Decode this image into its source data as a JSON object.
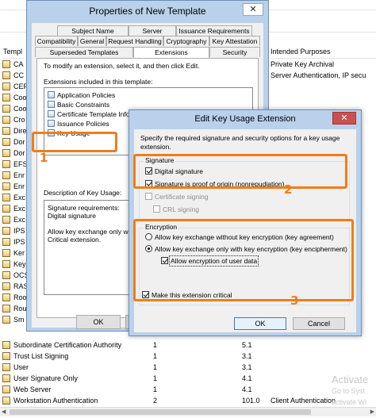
{
  "console": {
    "columns": {
      "name": "Templ",
      "intended_purposes": "Intended Purposes"
    },
    "top_rows": [
      {
        "name": "CA",
        "purposes": "Private Key Archival"
      },
      {
        "name": "CC",
        "purposes": "Server Authentication, IP secu"
      },
      {
        "name": "CEF",
        "purposes": ""
      },
      {
        "name": "Coo",
        "purposes": ""
      },
      {
        "name": "Coo",
        "purposes": ""
      },
      {
        "name": "Cro",
        "purposes": ""
      },
      {
        "name": "Dire",
        "purposes": ""
      },
      {
        "name": "Dor",
        "purposes": ""
      },
      {
        "name": "Dor",
        "purposes": ""
      },
      {
        "name": "EFS",
        "purposes": ""
      },
      {
        "name": "Enr",
        "purposes": ""
      },
      {
        "name": "Enr",
        "purposes": ""
      },
      {
        "name": "Exc",
        "purposes": ""
      },
      {
        "name": "Exc",
        "purposes": ""
      },
      {
        "name": "Exc",
        "purposes": ""
      },
      {
        "name": "IPS",
        "purposes": ""
      },
      {
        "name": "IPS",
        "purposes": ""
      },
      {
        "name": "Ker",
        "purposes": ""
      },
      {
        "name": "Key",
        "purposes": ""
      },
      {
        "name": "OCS",
        "purposes": ""
      },
      {
        "name": "RAS",
        "purposes": ""
      },
      {
        "name": "Roo",
        "purposes": ""
      },
      {
        "name": "Rou",
        "purposes": ""
      },
      {
        "name": "Sm",
        "purposes": ""
      }
    ],
    "bottom_rows": [
      {
        "name": "Subordinate Certification Authority",
        "c2": "1",
        "c3": "5.1",
        "purposes": ""
      },
      {
        "name": "Trust List Signing",
        "c2": "1",
        "c3": "3.1",
        "purposes": ""
      },
      {
        "name": "User",
        "c2": "1",
        "c3": "3.1",
        "purposes": ""
      },
      {
        "name": "User Signature Only",
        "c2": "1",
        "c3": "4.1",
        "purposes": ""
      },
      {
        "name": "Web Server",
        "c2": "1",
        "c3": "4.1",
        "purposes": ""
      },
      {
        "name": "Workstation Authentication",
        "c2": "2",
        "c3": "101.0",
        "purposes": "Client Authentication"
      }
    ],
    "watermark_line1": "Activate",
    "watermark_line2": "Go to Syst",
    "watermark_line3": "activate Wi"
  },
  "properties_dialog": {
    "title": "Properties of New Template",
    "close_glyph": "✕",
    "tabs_row1": [
      "Subject Name",
      "Server",
      "Issuance Requirements"
    ],
    "tabs_row2": [
      "Compatibility",
      "General",
      "Request Handling",
      "Cryptography",
      "Key Attestation"
    ],
    "tabs_row3": [
      "Superseded Templates",
      "Extensions",
      "Security"
    ],
    "instruction": "To modify an extension, select it, and then click Edit.",
    "list_label": "Extensions included in this template:",
    "extensions": [
      "Application Policies",
      "Basic Constraints",
      "Certificate Template Informa",
      "Issuance Policies",
      "Key Usage"
    ],
    "description_label": "Description of Key Usage:",
    "description_lines": [
      "Signature requirements:",
      "Digital signature",
      "",
      "Allow key exchange only with k",
      "Critical extension."
    ],
    "ok_label": "OK"
  },
  "key_usage_dialog": {
    "title": "Edit Key Usage Extension",
    "close_glyph": "✕",
    "description": "Specify the required signature and security options for a key usage extension.",
    "signature_group": "Signature",
    "digital_signature": "Digital signature",
    "proof_of_origin": "Signature is proof of origin (nonrepudiation)",
    "certificate_signing": "Certificate signing",
    "crl_signing": "CRL signing",
    "encryption_group": "Encryption",
    "radio_key_agreement": "Allow key exchange without key encryption (key agreement)",
    "radio_key_encipherment": "Allow key exchange only with key encryption (key encipherment)",
    "allow_user_data": "Allow encryption of user data",
    "critical": "Make this extension critical",
    "ok_label": "OK",
    "cancel_label": "Cancel"
  },
  "annotations": {
    "one": "1",
    "two": "2",
    "three": "3"
  },
  "colors": {
    "annotation": "#f07d1a",
    "titlebar": "#b9d1ea",
    "close_red": "#c75050"
  }
}
